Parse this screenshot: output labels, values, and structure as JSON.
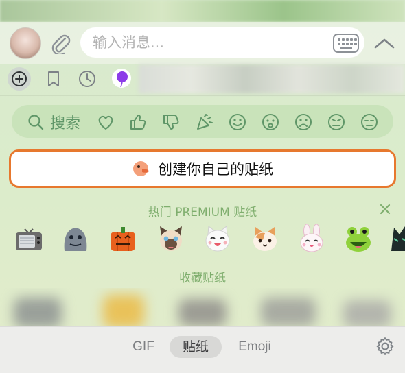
{
  "composer": {
    "placeholder": "输入消息..."
  },
  "panel_tabs": [
    "add-icon",
    "bookmark-icon",
    "recent-icon",
    "purple-pack-icon"
  ],
  "search": {
    "label": "搜索",
    "categories": [
      "heart-icon",
      "thumbs-up-icon",
      "thumbs-down-icon",
      "party-icon",
      "smile-icon",
      "worried-icon",
      "frown-icon",
      "annoyed-icon",
      "neutral-icon"
    ]
  },
  "create_button": {
    "label": "创建你自己的贴纸"
  },
  "hot": {
    "title": "热门 PREMIUM 贴纸",
    "stickers": [
      "tv-sticker",
      "gray-cat-sticker",
      "pumpkin-sticker",
      "siamese-cat-sticker",
      "white-cat-sticker",
      "calico-cat-sticker",
      "pink-bunny-sticker",
      "frog-sticker",
      "dark-sticker"
    ]
  },
  "favorites": {
    "title": "收藏贴纸"
  },
  "bottom_tabs": {
    "gif": "GIF",
    "stickers": "贴纸",
    "emoji": "Emoji",
    "active": "贴纸"
  },
  "colors": {
    "accent_orange": "#e7782e",
    "label_green": "#7fae6e",
    "search_pill": "#c9e3ba"
  }
}
